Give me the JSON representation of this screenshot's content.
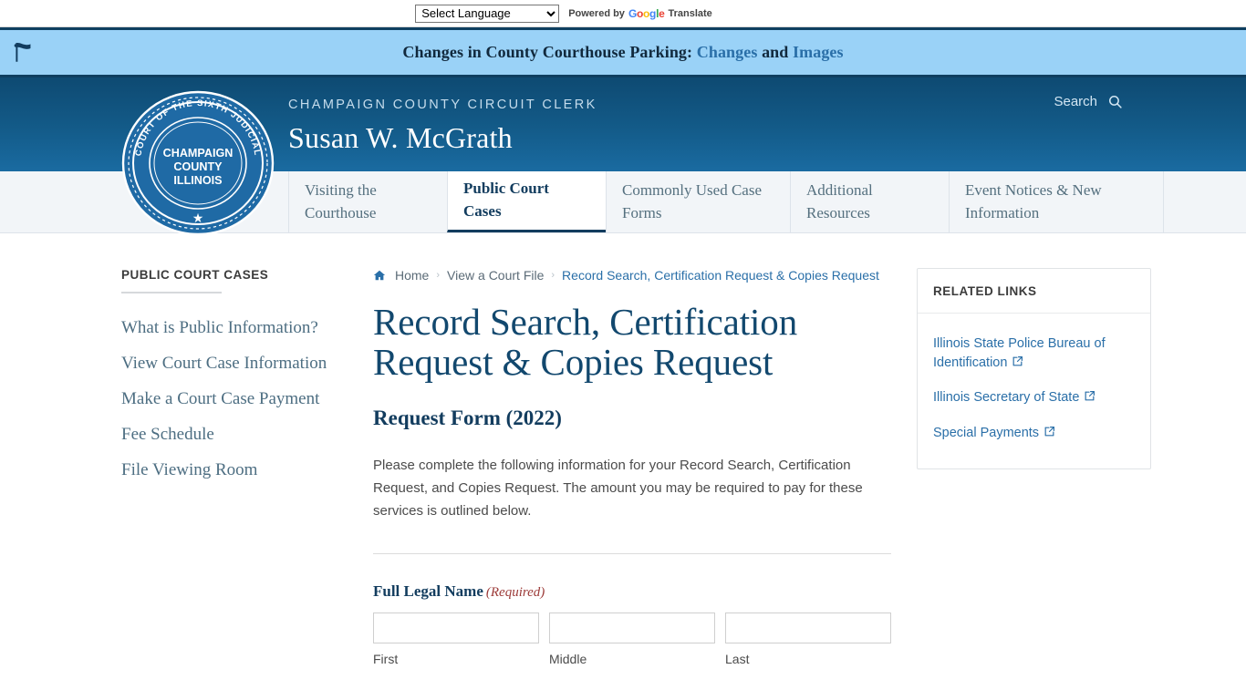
{
  "translate_bar": {
    "select_value": "Select Language",
    "options": [
      "Select Language"
    ],
    "powered_by": "Powered by",
    "google_letters": [
      "G",
      "o",
      "o",
      "g",
      "l",
      "e"
    ],
    "translate_label": "Translate"
  },
  "notice": {
    "icon": "flag-icon",
    "text_prefix": "Changes in County Courthouse Parking:",
    "link_changes": "Changes",
    "conjunction": "and",
    "link_images": "Images",
    "background": "#9ad2f7",
    "border_color": "#0e3f60"
  },
  "header": {
    "eyebrow": "CHAMPAIGN COUNTY CIRCUIT CLERK",
    "clerk_name": "Susan W. McGrath",
    "search_label": "Search",
    "search_icon": "search-icon",
    "accent": "#12486e",
    "seal": {
      "outer_text": "CIRCUIT COURT OF THE SIXTH JUDICIAL CIRCUIT",
      "line1": "CHAMPAIGN",
      "line2": "COUNTY",
      "line3": "ILLINOIS",
      "star": "★"
    }
  },
  "nav": {
    "items": [
      {
        "label": "Visiting the Courthouse",
        "active": false
      },
      {
        "label": "Public Court Cases",
        "active": true
      },
      {
        "label": "Commonly Used Case Forms",
        "active": false
      },
      {
        "label": "Additional Resources",
        "active": false
      },
      {
        "label": "Event Notices & New Information",
        "active": false
      }
    ]
  },
  "sidebar": {
    "title": "PUBLIC COURT CASES",
    "items": [
      {
        "label": "What is Public Information?"
      },
      {
        "label": "View Court Case Information"
      },
      {
        "label": "Make a Court Case Payment"
      },
      {
        "label": "Fee Schedule"
      },
      {
        "label": "File Viewing Room"
      }
    ]
  },
  "breadcrumb": {
    "home_icon": "home-icon",
    "items": [
      {
        "label": "Home",
        "current": false
      },
      {
        "label": "View a Court File",
        "current": false
      },
      {
        "label": "Record Search, Certification Request & Copies Request",
        "current": true
      }
    ],
    "separator": "›"
  },
  "main": {
    "page_title": "Record Search, Certification Request & Copies Request",
    "form_heading": "Request Form (2022)",
    "intro": "Please complete the following information for your Record Search, Certification Request, and Copies Request. The amount you may be required to pay for these services is outlined below.",
    "field_full_name": {
      "label": "Full Legal Name",
      "required_tag": "(Required)",
      "parts": [
        {
          "sub_label": "First",
          "value": "",
          "placeholder": ""
        },
        {
          "sub_label": "Middle",
          "value": "",
          "placeholder": ""
        },
        {
          "sub_label": "Last",
          "value": "",
          "placeholder": ""
        }
      ]
    }
  },
  "related_links": {
    "title": "RELATED LINKS",
    "items": [
      {
        "label": "Illinois State Police Bureau of Identification",
        "icon": "external-link-icon"
      },
      {
        "label": "Illinois Secretary of State",
        "icon": "external-link-icon"
      },
      {
        "label": "Special Payments",
        "icon": "external-link-icon"
      }
    ]
  }
}
